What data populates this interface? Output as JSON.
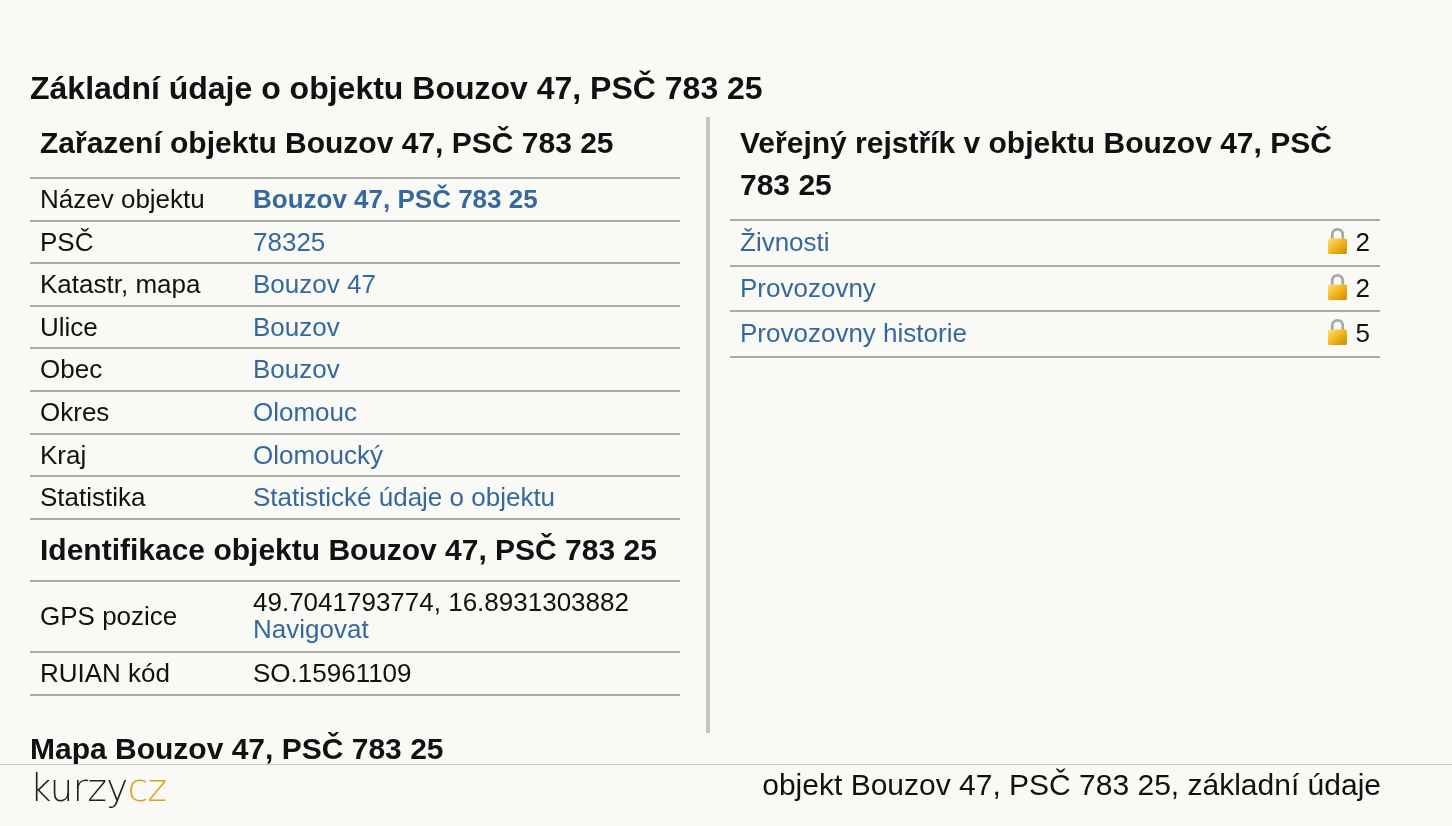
{
  "page_title": "Základní údaje o objektu Bouzov 47, PSČ 783 25",
  "classification": {
    "title": "Zařazení objektu Bouzov 47, PSČ 783 25",
    "rows": [
      {
        "label": "Název objektu",
        "kind": "strong_link",
        "value": "Bouzov 47, PSČ 783 25"
      },
      {
        "label": "PSČ",
        "kind": "link",
        "value": "78325"
      },
      {
        "label": "Katastr, mapa",
        "kind": "link",
        "value": "Bouzov 47"
      },
      {
        "label": "Ulice",
        "kind": "link",
        "value": "Bouzov"
      },
      {
        "label": "Obec",
        "kind": "link",
        "value": "Bouzov"
      },
      {
        "label": "Okres",
        "kind": "link",
        "value": "Olomouc"
      },
      {
        "label": "Kraj",
        "kind": "link",
        "value": "Olomoucký"
      },
      {
        "label": "Statistika",
        "kind": "link",
        "value": "Statistické údaje o objektu"
      }
    ]
  },
  "identification": {
    "title": "Identifikace objektu Bouzov 47, PSČ 783 25",
    "rows": [
      {
        "label": "GPS pozice",
        "kind": "text_link",
        "value": "49.7041793774, 16.8931303882",
        "link": "Navigovat"
      },
      {
        "label": "RUIAN kód",
        "kind": "text",
        "value": "SO.15961109"
      }
    ]
  },
  "public_register": {
    "title": "Veřejný rejstřík v objektu Bouzov 47, PSČ 783 25",
    "items": [
      {
        "label": "Živnosti",
        "count": "2"
      },
      {
        "label": "Provozovny",
        "count": "2"
      },
      {
        "label": "Provozovny historie",
        "count": "5"
      }
    ]
  },
  "map_section": {
    "title": "Mapa Bouzov 47, PSČ 783 25"
  },
  "footer": {
    "logo": {
      "main": "kurzy",
      "accent": "cz"
    },
    "caption": "objekt Bouzov 47, PSČ 783 25, základní údaje"
  }
}
